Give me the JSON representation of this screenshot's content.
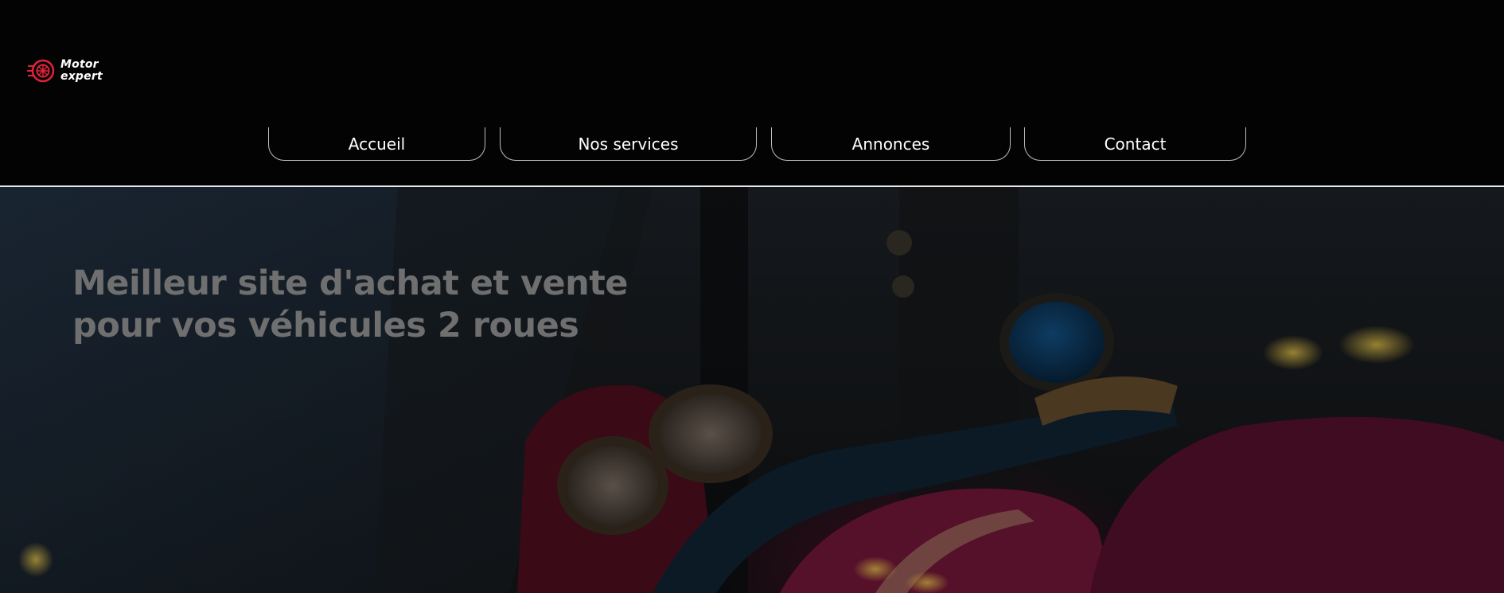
{
  "brand": {
    "line1": "Motor",
    "line2": "expert",
    "accent": "#e0223a"
  },
  "nav": {
    "items": [
      {
        "label": "Accueil"
      },
      {
        "label": "Nos services"
      },
      {
        "label": "Annonces"
      },
      {
        "label": "Contact"
      }
    ]
  },
  "hero": {
    "title_line1": "Meilleur site d'achat et vente",
    "title_line2": "pour vos véhicules 2 roues",
    "background_image": "motorcycle-dashboard-photo"
  },
  "colors": {
    "header_bg": "#030303",
    "nav_text": "#ffffff",
    "nav_border": "#bdbdbd",
    "hero_title": "#6f6f6f"
  }
}
